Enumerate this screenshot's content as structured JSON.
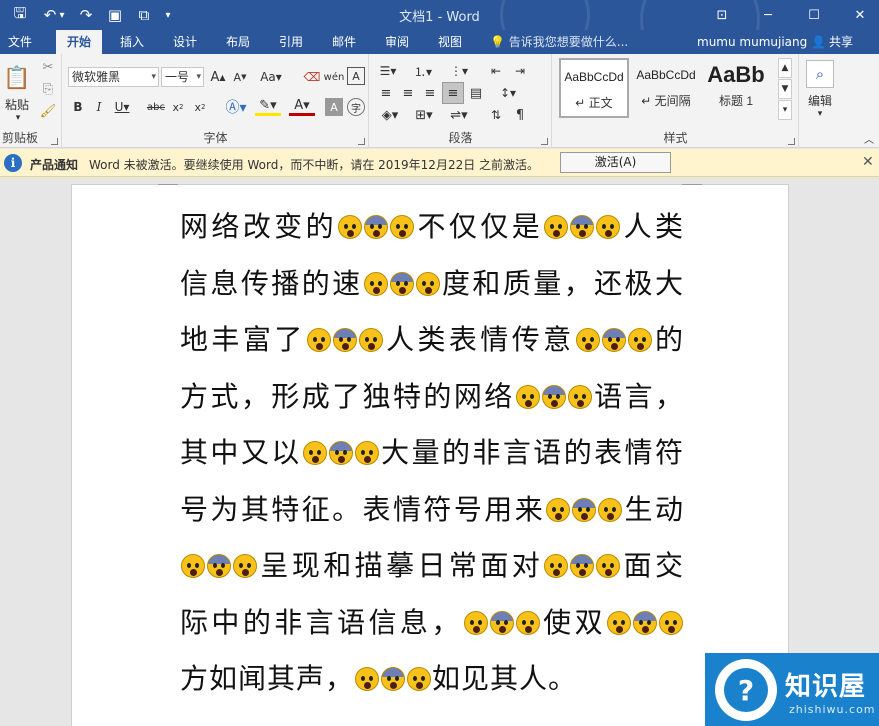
{
  "window": {
    "title": "文档1 - Word",
    "colors": {
      "accent": "#2b579a",
      "ribbon": "#f3f3f3",
      "notify": "#fff4ce",
      "emoji": "#f8c21a",
      "watermark": "#1a82cc"
    }
  },
  "quick_access": [
    {
      "name": "save-icon",
      "glyph": "🖫"
    },
    {
      "name": "undo-icon",
      "glyph": "↶"
    },
    {
      "name": "undo-dropdown-icon",
      "glyph": "▾"
    },
    {
      "name": "redo-icon",
      "glyph": "↷"
    },
    {
      "name": "presentation-icon",
      "glyph": "▣"
    },
    {
      "name": "copy-format-icon",
      "glyph": "⧉"
    },
    {
      "name": "customize-qat-icon",
      "glyph": "▾"
    }
  ],
  "tabs": [
    "文件",
    "开始",
    "插入",
    "设计",
    "布局",
    "引用",
    "邮件",
    "审阅",
    "视图"
  ],
  "active_tab": "开始",
  "tell_me": "告诉我您想要做什么...",
  "user": "mumu mumujiang",
  "share_label": "共享",
  "clipboard": {
    "paste_label": "粘贴",
    "group_label": "剪贴板"
  },
  "font": {
    "name": "微软雅黑",
    "size": "一号",
    "group_label": "字体"
  },
  "paragraph": {
    "group_label": "段落"
  },
  "styles": {
    "group_label": "样式",
    "items": [
      {
        "preview": "AaBbCcDd",
        "name": "↵ 正文"
      },
      {
        "preview": "AaBbCcDd",
        "name": "↵ 无间隔"
      },
      {
        "preview": "AaBb",
        "name": "标题 1"
      }
    ]
  },
  "editing": {
    "label": "编辑"
  },
  "notification": {
    "label": "产品通知",
    "message": "Word 未被激活。要继续使用 Word，而不中断，请在 2019年12月22日 之前激活。",
    "button": "激活(A)"
  },
  "document": {
    "segments": [
      "网络改变的",
      "E",
      "不仅仅是",
      "E",
      "人类信息传播的速",
      "E",
      "度和质量，还极大地丰富了",
      "E",
      "人类表情传意",
      "E",
      "的方式，形成了独特的网络",
      "E",
      "语言，其中又以",
      "E",
      "大量的非言语的表情符号为其特征。表情符号用来",
      "E",
      "生动",
      "E",
      "呈现和描摹日常面对",
      "E",
      "面交际中的非言语信息，",
      "E",
      "使双",
      "E",
      "方如闻其声，",
      "E",
      "如见其人。"
    ]
  },
  "watermark": {
    "brand": "知识屋",
    "url": "zhishiwu.com"
  }
}
